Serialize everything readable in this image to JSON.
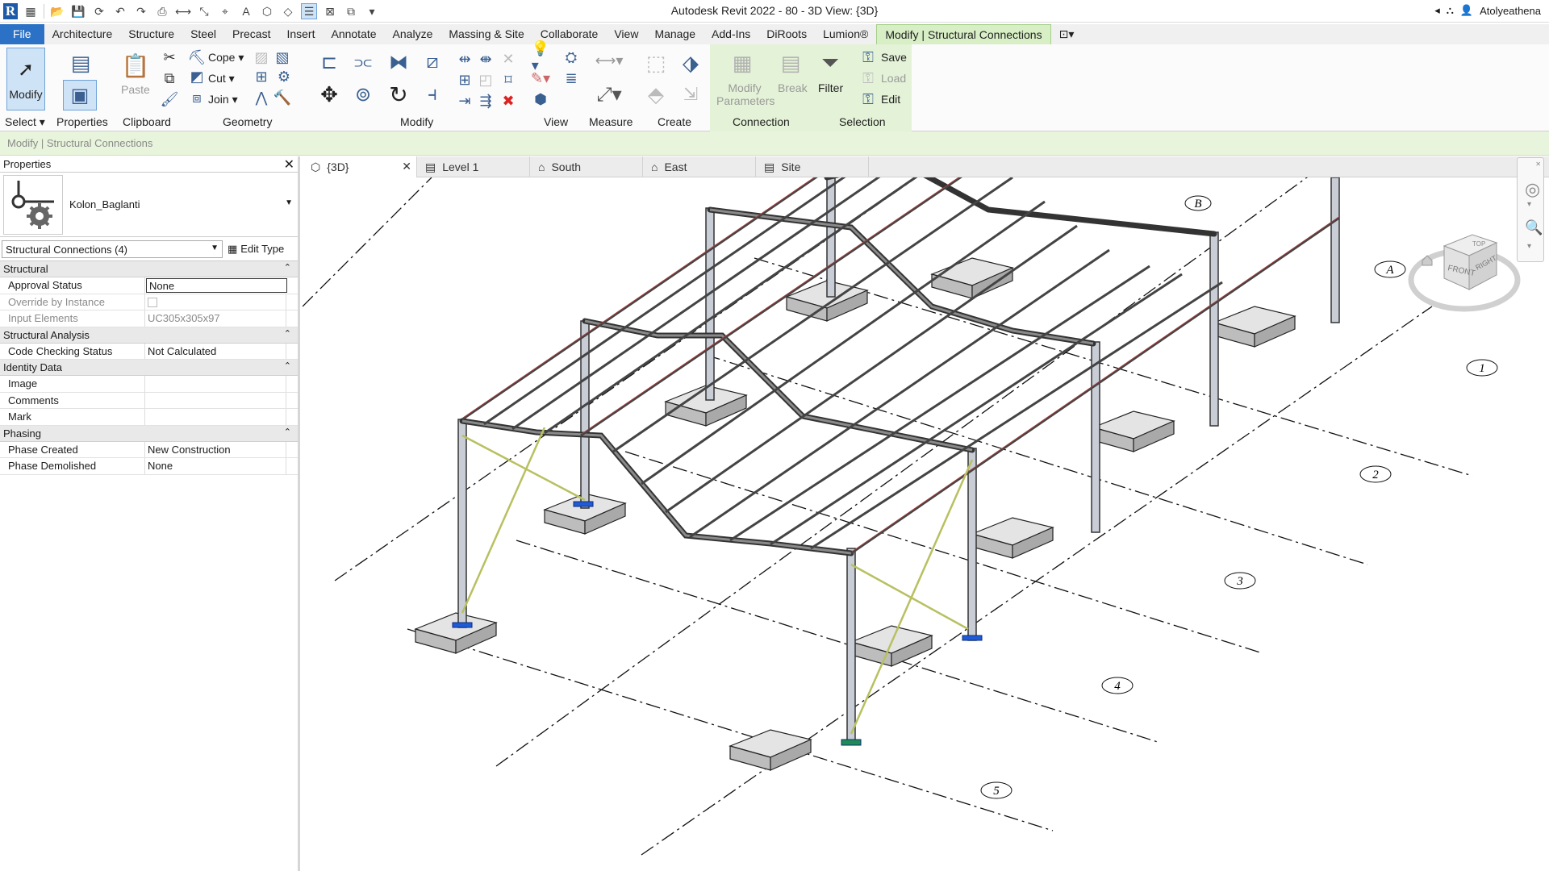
{
  "app": {
    "title": "Autodesk Revit 2022 - 80 - 3D View: {3D}",
    "user": "Atolyeathena"
  },
  "tabs": [
    "File",
    "Architecture",
    "Structure",
    "Steel",
    "Precast",
    "Insert",
    "Annotate",
    "Analyze",
    "Massing & Site",
    "Collaborate",
    "View",
    "Manage",
    "Add-Ins",
    "DiRoots",
    "Lumion®",
    "Modify | Structural Connections"
  ],
  "ribbon": {
    "modify": "Modify",
    "properties": "Properties",
    "paste": "Paste",
    "cope": "Cope",
    "cut": "Cut",
    "join": "Join",
    "modify_parameters": "Modify Parameters",
    "break": "Break",
    "filter": "Filter",
    "save": "Save",
    "load": "Load",
    "edit": "Edit",
    "panels": {
      "select": "Select",
      "properties": "Properties",
      "clipboard": "Clipboard",
      "geometry": "Geometry",
      "modify": "Modify",
      "view": "View",
      "measure": "Measure",
      "create": "Create",
      "connection": "Connection",
      "selection": "Selection"
    }
  },
  "options_bar": "Modify | Structural Connections",
  "properties": {
    "title": "Properties",
    "type_name": "Kolon_Baglanti",
    "filter": "Structural Connections (4)",
    "edit_type": "Edit Type",
    "groups": [
      {
        "name": "Structural",
        "rows": [
          {
            "k": "Approval Status",
            "v": "None"
          },
          {
            "k": "Override by Instance",
            "v": ""
          },
          {
            "k": "Input Elements",
            "v": "UC305x305x97"
          }
        ]
      },
      {
        "name": "Structural Analysis",
        "rows": [
          {
            "k": "Code Checking Status",
            "v": "Not Calculated"
          }
        ]
      },
      {
        "name": "Identity Data",
        "rows": [
          {
            "k": "Image",
            "v": ""
          },
          {
            "k": "Comments",
            "v": ""
          },
          {
            "k": "Mark",
            "v": ""
          }
        ]
      },
      {
        "name": "Phasing",
        "rows": [
          {
            "k": "Phase Created",
            "v": "New Construction"
          },
          {
            "k": "Phase Demolished",
            "v": "None"
          }
        ]
      }
    ]
  },
  "view_tabs": [
    "{3D}",
    "Level 1",
    "South",
    "East",
    "Site"
  ],
  "viewcube": {
    "top": "TOP",
    "front": "FRONT",
    "right": "RIGHT"
  },
  "grids": [
    "A",
    "B",
    "1",
    "2",
    "3",
    "4",
    "5"
  ]
}
